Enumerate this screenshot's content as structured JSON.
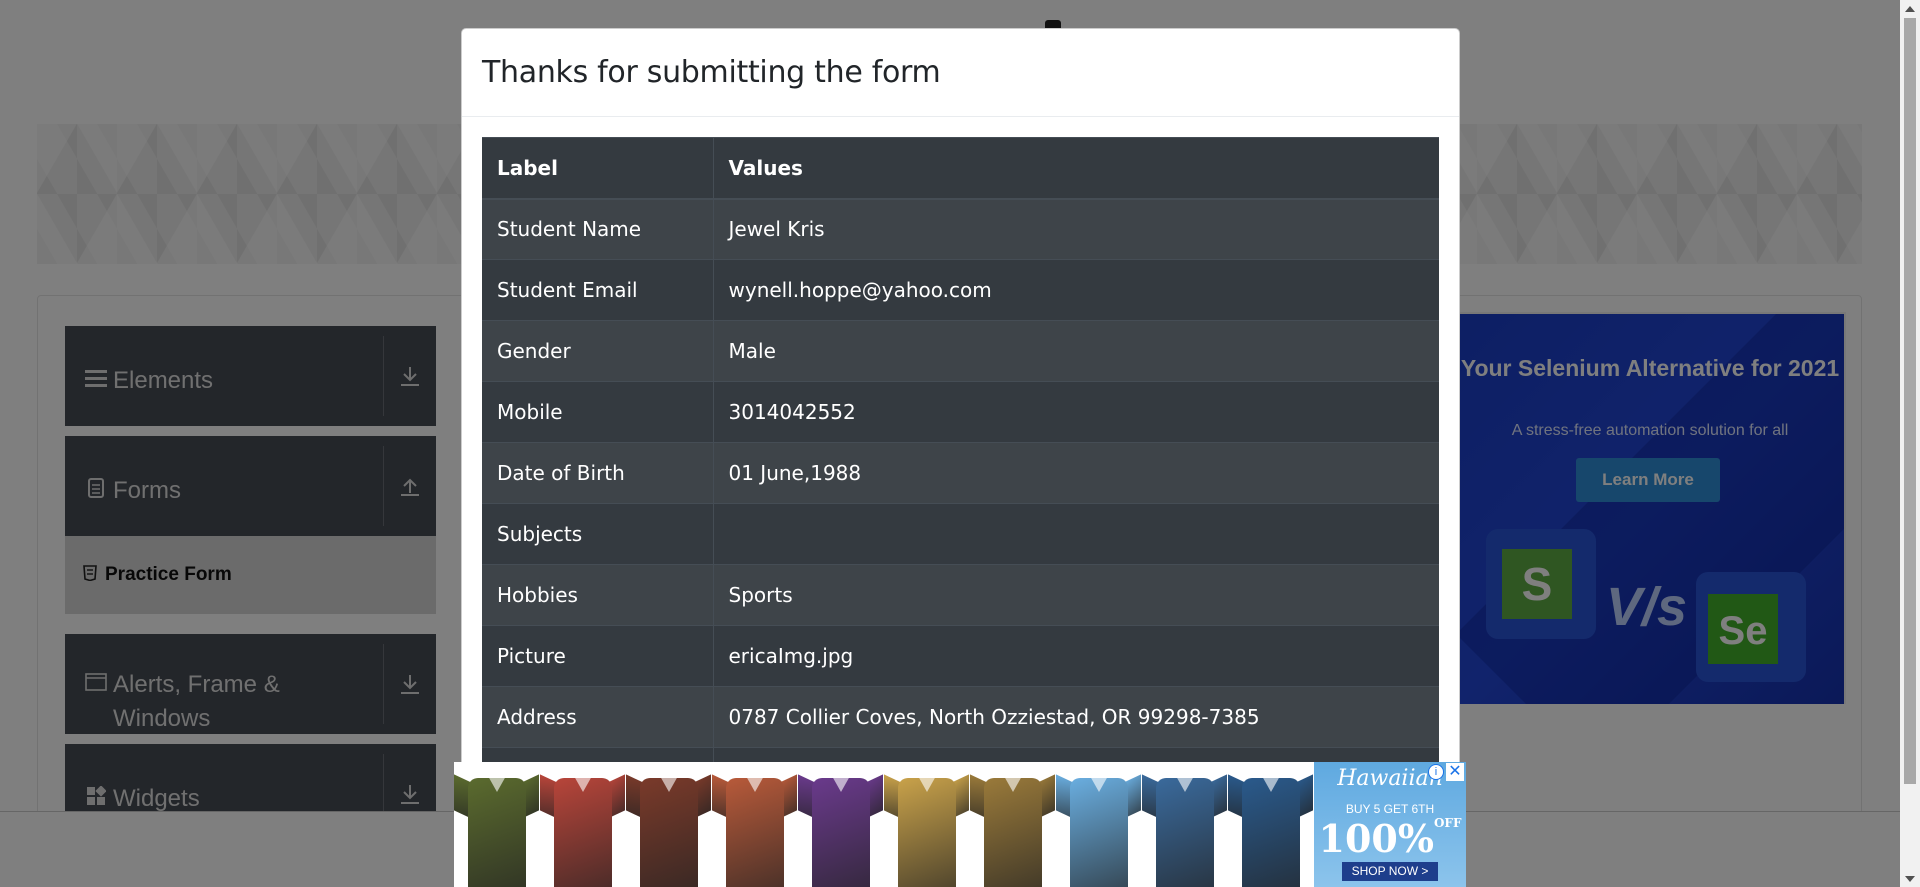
{
  "sidebar": {
    "groups": [
      {
        "label": "Elements",
        "icon": "hamburger-icon",
        "toggle_icon": "download-icon"
      },
      {
        "label": "Forms",
        "icon": "document-icon",
        "toggle_icon": "upload-icon"
      },
      {
        "label": "Alerts, Frame & Windows",
        "icon": "window-icon",
        "toggle_icon": "download-icon"
      },
      {
        "label": "Widgets",
        "icon": "widgets-icon",
        "toggle_icon": "download-icon"
      }
    ],
    "active_item": {
      "label": "Practice Form",
      "icon": "html5-icon"
    }
  },
  "side_ad": {
    "title": "Your Selenium Alternative for 2021",
    "subtitle": "A stress-free automation solution for all",
    "button": "Learn More",
    "logo_left": "S",
    "versus": "V/s",
    "logo_right": "Se"
  },
  "modal": {
    "title": "Thanks for submitting the form",
    "headers": [
      "Label",
      "Values"
    ],
    "rows": [
      {
        "label": "Student Name",
        "value": "Jewel Kris"
      },
      {
        "label": "Student Email",
        "value": "wynell.hoppe@yahoo.com"
      },
      {
        "label": "Gender",
        "value": "Male"
      },
      {
        "label": "Mobile",
        "value": "3014042552"
      },
      {
        "label": "Date of Birth",
        "value": "01 June,1988"
      },
      {
        "label": "Subjects",
        "value": ""
      },
      {
        "label": "Hobbies",
        "value": "Sports"
      },
      {
        "label": "Picture",
        "value": "ericaImg.jpg"
      },
      {
        "label": "Address",
        "value": "0787 Collier Coves, North Ozziestad, OR 99298-7385"
      }
    ]
  },
  "bottom_ad": {
    "brand": "Hawaiian",
    "offer_line": "BUY 5 GET 6TH",
    "discount": "100%",
    "discount_suffix": "OFF",
    "cta": "SHOP NOW >",
    "shirt_colors": [
      "#5b6b2e",
      "#b8453a",
      "#7a3a2a",
      "#b85a3a",
      "#6a3a8c",
      "#c9a24a",
      "#9a7a3a",
      "#6aaee0",
      "#3a6a9c",
      "#2a5a8c"
    ]
  }
}
